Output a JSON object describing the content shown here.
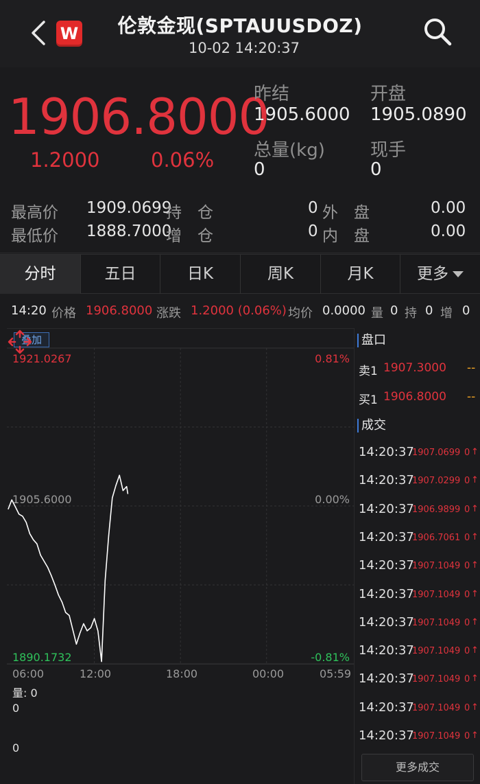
{
  "header": {
    "title": "伦敦金现(SPTAUUSDOZ)",
    "datetime": "10-02 14:20:37",
    "app_badge": "W"
  },
  "quote": {
    "last_price": "1906.8000",
    "change": "1.2000",
    "change_pct": "0.06%",
    "prev_settle_label": "昨结",
    "prev_settle": "1905.6000",
    "open_label": "开盘",
    "open": "1905.0890",
    "volume_label": "总量(kg)",
    "volume": "0",
    "last_vol_label": "现手",
    "last_vol": "0",
    "high_label": "最高价",
    "high": "1909.0699",
    "low_label": "最低价",
    "low": "1888.7000",
    "oi_label": "持　仓",
    "oi": "0",
    "oi_chg_label": "增　仓",
    "oi_chg": "0",
    "outer_label": "外　盘",
    "outer": "0.00",
    "inner_label": "内　盘",
    "inner": "0.00"
  },
  "tabs": [
    {
      "label": "分时",
      "active": true
    },
    {
      "label": "五日"
    },
    {
      "label": "日K"
    },
    {
      "label": "周K"
    },
    {
      "label": "月K"
    },
    {
      "label": "更多"
    }
  ],
  "info_strip": {
    "time": "14:20",
    "price_label": "价格",
    "price": "1906.8000",
    "chg_label": "涨跌",
    "chg": "1.2000 (0.06%)",
    "avg_label": "均价",
    "avg": "0.0000",
    "vol_label": "量",
    "vol": "0",
    "oi_label": "持",
    "oi": "0",
    "add_label": "增",
    "add": "0"
  },
  "chart": {
    "overlay_label": "叠加",
    "max_price": "1921.0267",
    "max_pct": "0.81%",
    "ref_price": "1905.6000",
    "ref_pct": "0.00%",
    "min_price": "1890.1732",
    "min_pct": "-0.81%",
    "time_labels": [
      "06:00",
      "12:00",
      "18:00",
      "00:00",
      "05:59"
    ],
    "volume_label": "量: 0",
    "volume_max": "0",
    "volume_min": "0",
    "colors": {
      "line": "#ffffff",
      "up": "#e0333d",
      "down": "#2fc25b",
      "grid": "#333335"
    }
  },
  "chart_data": {
    "type": "line",
    "title": "",
    "xlabel": "",
    "ylabel": "",
    "ylim": [
      1890.1732,
      1921.0267
    ],
    "x_range": [
      "06:00",
      "05:59"
    ],
    "reference": 1905.6,
    "series": [
      {
        "x": [
          "06:00",
          "06:15",
          "06:30",
          "06:45",
          "07:00",
          "07:15",
          "07:30",
          "07:45",
          "08:00",
          "08:15",
          "08:30",
          "08:45",
          "09:00",
          "09:15",
          "09:30",
          "09:45",
          "10:00",
          "10:15",
          "10:30",
          "10:45",
          "11:00",
          "11:15",
          "11:30",
          "11:45",
          "12:00",
          "12:15",
          "12:30",
          "12:45",
          "13:00",
          "13:15",
          "13:30",
          "13:45",
          "14:00",
          "14:15",
          "14:20"
        ],
        "values": [
          1905.3,
          1906.2,
          1905.5,
          1904.8,
          1904.6,
          1904.0,
          1902.9,
          1902.3,
          1901.9,
          1900.8,
          1900.2,
          1899.6,
          1898.8,
          1897.9,
          1896.9,
          1896.2,
          1895.2,
          1894.9,
          1893.5,
          1892.1,
          1893.2,
          1894.1,
          1893.4,
          1893.7,
          1894.6,
          1893.4,
          1890.4,
          1898.3,
          1902.7,
          1906.4,
          1907.6,
          1908.6,
          1907.1,
          1907.5,
          1906.8
        ]
      }
    ]
  },
  "order_book": {
    "title": "盘口",
    "ask_label": "卖1",
    "ask": "1907.3000",
    "ask_vol": "--",
    "bid_label": "买1",
    "bid": "1906.8000",
    "bid_vol": "--"
  },
  "trades": {
    "title": "成交",
    "rows": [
      {
        "time": "14:20:37",
        "price": "1907.0699",
        "qty": "0"
      },
      {
        "time": "14:20:37",
        "price": "1907.0299",
        "qty": "0"
      },
      {
        "time": "14:20:37",
        "price": "1906.9899",
        "qty": "0"
      },
      {
        "time": "14:20:37",
        "price": "1906.7061",
        "qty": "0"
      },
      {
        "time": "14:20:37",
        "price": "1907.1049",
        "qty": "0"
      },
      {
        "time": "14:20:37",
        "price": "1907.1049",
        "qty": "0"
      },
      {
        "time": "14:20:37",
        "price": "1907.1049",
        "qty": "0"
      },
      {
        "time": "14:20:37",
        "price": "1907.1049",
        "qty": "0"
      },
      {
        "time": "14:20:37",
        "price": "1907.1049",
        "qty": "0"
      },
      {
        "time": "14:20:37",
        "price": "1907.1049",
        "qty": "0"
      },
      {
        "time": "14:20:37",
        "price": "1907.1049",
        "qty": "0"
      }
    ],
    "more_label": "更多成交"
  }
}
